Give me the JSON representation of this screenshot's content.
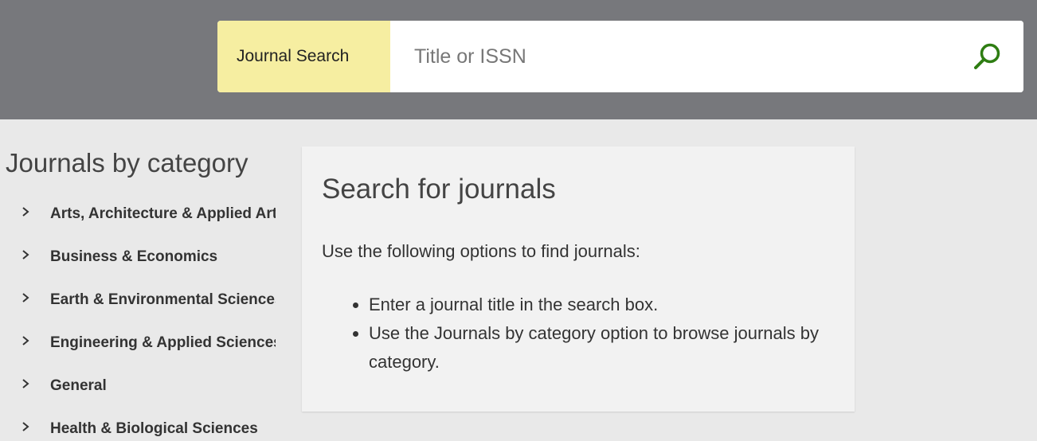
{
  "header": {
    "search_label": "Journal Search",
    "search_placeholder": "Title or ISSN",
    "search_icon": "magnifier-icon",
    "accent_color": "#2e7d12"
  },
  "sidebar": {
    "title": "Journals by category",
    "items": [
      {
        "label": "Arts, Architecture & Applied Arts"
      },
      {
        "label": "Business & Economics"
      },
      {
        "label": "Earth & Environmental Sciences"
      },
      {
        "label": "Engineering & Applied Sciences"
      },
      {
        "label": "General"
      },
      {
        "label": "Health & Biological Sciences"
      }
    ]
  },
  "main": {
    "title": "Search for journals",
    "intro": "Use the following options to find journals:",
    "options": [
      "Enter a journal title in the search box.",
      "Use the Journals by category option to browse journals by category."
    ]
  }
}
